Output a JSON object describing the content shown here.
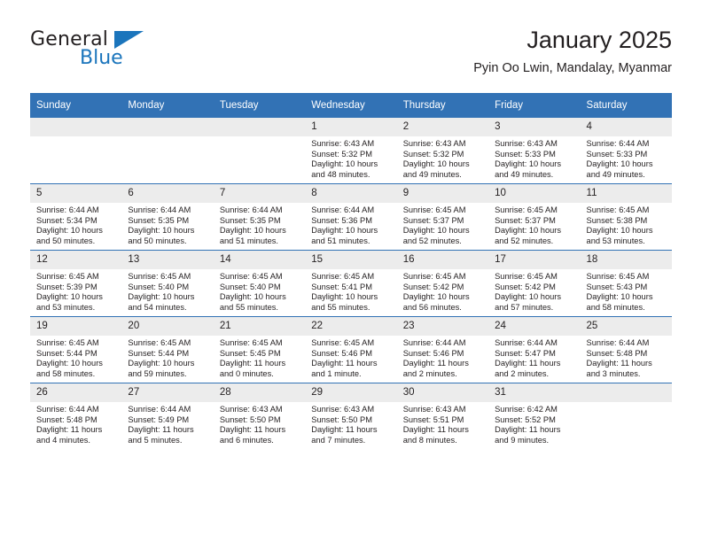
{
  "brand": {
    "name_top": "General",
    "name_bottom": "Blue",
    "accent_color": "#1b75bc"
  },
  "header": {
    "title": "January 2025",
    "subtitle": "Pyin Oo Lwin, Mandalay, Myanmar"
  },
  "calendar": {
    "header_bg": "#3272b5",
    "daynum_bg": "#ececec",
    "weekday_labels": [
      "Sunday",
      "Monday",
      "Tuesday",
      "Wednesday",
      "Thursday",
      "Friday",
      "Saturday"
    ],
    "labels": {
      "sunrise": "Sunrise:",
      "sunset": "Sunset:",
      "daylight": "Daylight:"
    },
    "weeks": [
      [
        {
          "day": "",
          "empty": true
        },
        {
          "day": "",
          "empty": true
        },
        {
          "day": "",
          "empty": true
        },
        {
          "day": "1",
          "sunrise": "Sunrise: 6:43 AM",
          "sunset": "Sunset: 5:32 PM",
          "daylight_1": "Daylight: 10 hours",
          "daylight_2": "and 48 minutes."
        },
        {
          "day": "2",
          "sunrise": "Sunrise: 6:43 AM",
          "sunset": "Sunset: 5:32 PM",
          "daylight_1": "Daylight: 10 hours",
          "daylight_2": "and 49 minutes."
        },
        {
          "day": "3",
          "sunrise": "Sunrise: 6:43 AM",
          "sunset": "Sunset: 5:33 PM",
          "daylight_1": "Daylight: 10 hours",
          "daylight_2": "and 49 minutes."
        },
        {
          "day": "4",
          "sunrise": "Sunrise: 6:44 AM",
          "sunset": "Sunset: 5:33 PM",
          "daylight_1": "Daylight: 10 hours",
          "daylight_2": "and 49 minutes."
        }
      ],
      [
        {
          "day": "5",
          "sunrise": "Sunrise: 6:44 AM",
          "sunset": "Sunset: 5:34 PM",
          "daylight_1": "Daylight: 10 hours",
          "daylight_2": "and 50 minutes."
        },
        {
          "day": "6",
          "sunrise": "Sunrise: 6:44 AM",
          "sunset": "Sunset: 5:35 PM",
          "daylight_1": "Daylight: 10 hours",
          "daylight_2": "and 50 minutes."
        },
        {
          "day": "7",
          "sunrise": "Sunrise: 6:44 AM",
          "sunset": "Sunset: 5:35 PM",
          "daylight_1": "Daylight: 10 hours",
          "daylight_2": "and 51 minutes."
        },
        {
          "day": "8",
          "sunrise": "Sunrise: 6:44 AM",
          "sunset": "Sunset: 5:36 PM",
          "daylight_1": "Daylight: 10 hours",
          "daylight_2": "and 51 minutes."
        },
        {
          "day": "9",
          "sunrise": "Sunrise: 6:45 AM",
          "sunset": "Sunset: 5:37 PM",
          "daylight_1": "Daylight: 10 hours",
          "daylight_2": "and 52 minutes."
        },
        {
          "day": "10",
          "sunrise": "Sunrise: 6:45 AM",
          "sunset": "Sunset: 5:37 PM",
          "daylight_1": "Daylight: 10 hours",
          "daylight_2": "and 52 minutes."
        },
        {
          "day": "11",
          "sunrise": "Sunrise: 6:45 AM",
          "sunset": "Sunset: 5:38 PM",
          "daylight_1": "Daylight: 10 hours",
          "daylight_2": "and 53 minutes."
        }
      ],
      [
        {
          "day": "12",
          "sunrise": "Sunrise: 6:45 AM",
          "sunset": "Sunset: 5:39 PM",
          "daylight_1": "Daylight: 10 hours",
          "daylight_2": "and 53 minutes."
        },
        {
          "day": "13",
          "sunrise": "Sunrise: 6:45 AM",
          "sunset": "Sunset: 5:40 PM",
          "daylight_1": "Daylight: 10 hours",
          "daylight_2": "and 54 minutes."
        },
        {
          "day": "14",
          "sunrise": "Sunrise: 6:45 AM",
          "sunset": "Sunset: 5:40 PM",
          "daylight_1": "Daylight: 10 hours",
          "daylight_2": "and 55 minutes."
        },
        {
          "day": "15",
          "sunrise": "Sunrise: 6:45 AM",
          "sunset": "Sunset: 5:41 PM",
          "daylight_1": "Daylight: 10 hours",
          "daylight_2": "and 55 minutes."
        },
        {
          "day": "16",
          "sunrise": "Sunrise: 6:45 AM",
          "sunset": "Sunset: 5:42 PM",
          "daylight_1": "Daylight: 10 hours",
          "daylight_2": "and 56 minutes."
        },
        {
          "day": "17",
          "sunrise": "Sunrise: 6:45 AM",
          "sunset": "Sunset: 5:42 PM",
          "daylight_1": "Daylight: 10 hours",
          "daylight_2": "and 57 minutes."
        },
        {
          "day": "18",
          "sunrise": "Sunrise: 6:45 AM",
          "sunset": "Sunset: 5:43 PM",
          "daylight_1": "Daylight: 10 hours",
          "daylight_2": "and 58 minutes."
        }
      ],
      [
        {
          "day": "19",
          "sunrise": "Sunrise: 6:45 AM",
          "sunset": "Sunset: 5:44 PM",
          "daylight_1": "Daylight: 10 hours",
          "daylight_2": "and 58 minutes."
        },
        {
          "day": "20",
          "sunrise": "Sunrise: 6:45 AM",
          "sunset": "Sunset: 5:44 PM",
          "daylight_1": "Daylight: 10 hours",
          "daylight_2": "and 59 minutes."
        },
        {
          "day": "21",
          "sunrise": "Sunrise: 6:45 AM",
          "sunset": "Sunset: 5:45 PM",
          "daylight_1": "Daylight: 11 hours",
          "daylight_2": "and 0 minutes."
        },
        {
          "day": "22",
          "sunrise": "Sunrise: 6:45 AM",
          "sunset": "Sunset: 5:46 PM",
          "daylight_1": "Daylight: 11 hours",
          "daylight_2": "and 1 minute."
        },
        {
          "day": "23",
          "sunrise": "Sunrise: 6:44 AM",
          "sunset": "Sunset: 5:46 PM",
          "daylight_1": "Daylight: 11 hours",
          "daylight_2": "and 2 minutes."
        },
        {
          "day": "24",
          "sunrise": "Sunrise: 6:44 AM",
          "sunset": "Sunset: 5:47 PM",
          "daylight_1": "Daylight: 11 hours",
          "daylight_2": "and 2 minutes."
        },
        {
          "day": "25",
          "sunrise": "Sunrise: 6:44 AM",
          "sunset": "Sunset: 5:48 PM",
          "daylight_1": "Daylight: 11 hours",
          "daylight_2": "and 3 minutes."
        }
      ],
      [
        {
          "day": "26",
          "sunrise": "Sunrise: 6:44 AM",
          "sunset": "Sunset: 5:48 PM",
          "daylight_1": "Daylight: 11 hours",
          "daylight_2": "and 4 minutes."
        },
        {
          "day": "27",
          "sunrise": "Sunrise: 6:44 AM",
          "sunset": "Sunset: 5:49 PM",
          "daylight_1": "Daylight: 11 hours",
          "daylight_2": "and 5 minutes."
        },
        {
          "day": "28",
          "sunrise": "Sunrise: 6:43 AM",
          "sunset": "Sunset: 5:50 PM",
          "daylight_1": "Daylight: 11 hours",
          "daylight_2": "and 6 minutes."
        },
        {
          "day": "29",
          "sunrise": "Sunrise: 6:43 AM",
          "sunset": "Sunset: 5:50 PM",
          "daylight_1": "Daylight: 11 hours",
          "daylight_2": "and 7 minutes."
        },
        {
          "day": "30",
          "sunrise": "Sunrise: 6:43 AM",
          "sunset": "Sunset: 5:51 PM",
          "daylight_1": "Daylight: 11 hours",
          "daylight_2": "and 8 minutes."
        },
        {
          "day": "31",
          "sunrise": "Sunrise: 6:42 AM",
          "sunset": "Sunset: 5:52 PM",
          "daylight_1": "Daylight: 11 hours",
          "daylight_2": "and 9 minutes."
        },
        {
          "day": "",
          "empty": true
        }
      ]
    ]
  }
}
